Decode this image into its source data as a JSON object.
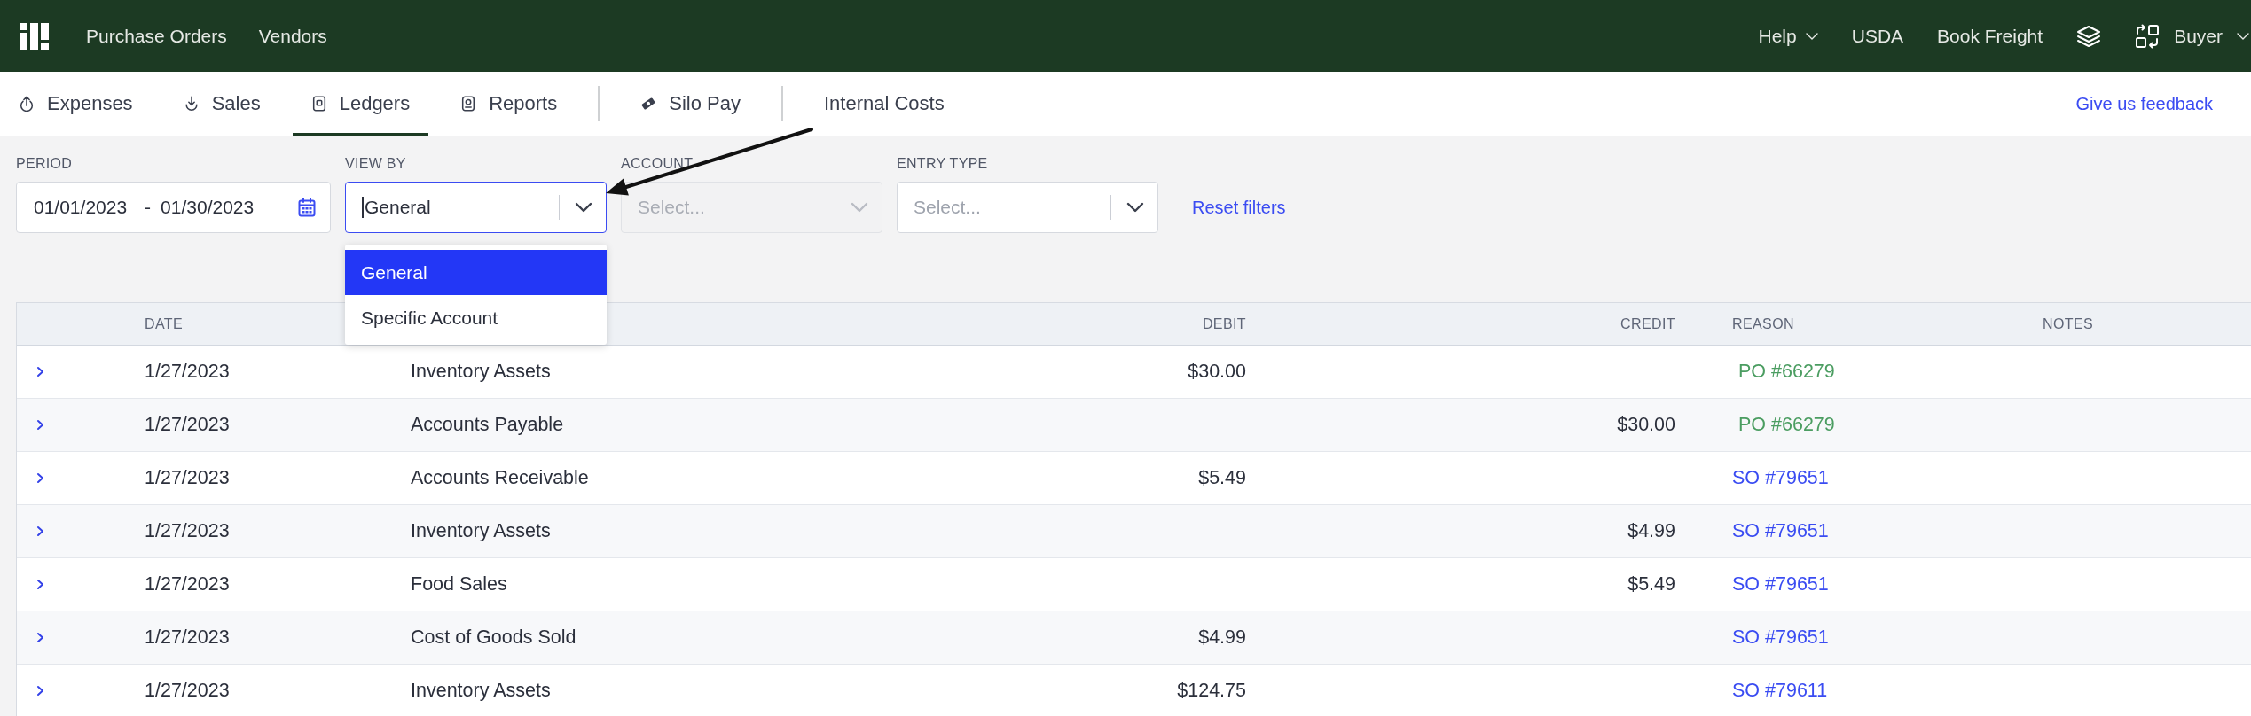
{
  "header": {
    "nav": [
      {
        "label": "Purchase Orders"
      },
      {
        "label": "Vendors"
      }
    ],
    "links": [
      {
        "label": "Help",
        "kind": "menu"
      },
      {
        "label": "USDA",
        "kind": "link"
      },
      {
        "label": "Book Freight",
        "kind": "link"
      }
    ],
    "role_menu": {
      "label": "Buyer"
    }
  },
  "tabs": {
    "groups": [
      [
        {
          "label": "Expenses",
          "selected": false
        },
        {
          "label": "Sales",
          "selected": false
        },
        {
          "label": "Ledgers",
          "selected": true
        },
        {
          "label": "Reports",
          "selected": false
        }
      ],
      [
        {
          "label": "Silo Pay",
          "selected": false
        }
      ],
      [
        {
          "label": "Internal Costs",
          "selected": false
        }
      ]
    ],
    "feedback_link": "Give us feedback"
  },
  "filters": {
    "period": {
      "label": "PERIOD",
      "start": "01/01/2023",
      "separator": "-",
      "end": "01/30/2023"
    },
    "view_by": {
      "label": "VIEW BY",
      "value": "General",
      "focused": true,
      "expanded": true,
      "options": [
        {
          "label": "General",
          "selected": true
        },
        {
          "label": "Specific Account",
          "selected": false
        }
      ]
    },
    "account": {
      "label": "ACCOUNT",
      "placeholder": "Select...",
      "disabled": true
    },
    "entry_type": {
      "label": "ENTRY TYPE",
      "placeholder": "Select...",
      "disabled": false
    },
    "reset_link": "Reset filters"
  },
  "table": {
    "columns": [
      "DATE",
      "DEBIT",
      "CREDIT",
      "REASON",
      "NOTES"
    ],
    "rows": [
      {
        "date": "1/27/2023",
        "account": "Inventory Assets",
        "debit": "$30.00",
        "reason": {
          "text": "PO #66279",
          "kind": "po"
        }
      },
      {
        "date": "1/27/2023",
        "account": "Accounts Payable",
        "credit": "$30.00",
        "reason": {
          "text": "PO #66279",
          "kind": "po"
        }
      },
      {
        "date": "1/27/2023",
        "account": "Accounts Receivable",
        "debit": "$5.49",
        "reason": {
          "text": "SO #79651",
          "kind": "so"
        }
      },
      {
        "date": "1/27/2023",
        "account": "Inventory Assets",
        "credit": "$4.99",
        "reason": {
          "text": "SO #79651",
          "kind": "so"
        }
      },
      {
        "date": "1/27/2023",
        "account": "Food Sales",
        "credit": "$5.49",
        "reason": {
          "text": "SO #79651",
          "kind": "so"
        }
      },
      {
        "date": "1/27/2023",
        "account": "Cost of Goods Sold",
        "debit": "$4.99",
        "reason": {
          "text": "SO #79651",
          "kind": "so"
        }
      },
      {
        "date": "1/27/2023",
        "account": "Inventory Assets",
        "debit": "$124.75",
        "reason": {
          "text": "SO #79611",
          "kind": "so"
        }
      }
    ]
  }
}
